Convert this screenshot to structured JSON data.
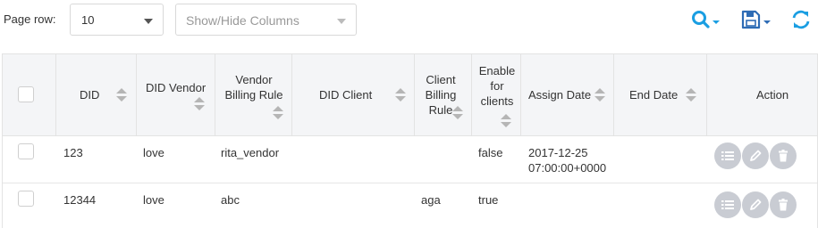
{
  "toolbar": {
    "page_row_label": "Page row:",
    "page_size_value": "10",
    "columns_placeholder": "Show/Hide Columns",
    "icons": {
      "search": "search-icon",
      "save": "save-icon",
      "refresh": "refresh-icon"
    },
    "accent_color": "#1a9ee2"
  },
  "table": {
    "columns": [
      {
        "key": "did",
        "label": "DID"
      },
      {
        "key": "did_vendor",
        "label": "DID Vendor"
      },
      {
        "key": "vendor_billing_rule",
        "label": "Vendor Billing Rule"
      },
      {
        "key": "did_client",
        "label": "DID Client"
      },
      {
        "key": "client_billing_rule",
        "label": "Client Billing Rule"
      },
      {
        "key": "enable_for_clients",
        "label": "Enable for clients"
      },
      {
        "key": "assign_date",
        "label": "Assign Date"
      },
      {
        "key": "end_date",
        "label": "End Date"
      },
      {
        "key": "action",
        "label": "Action"
      }
    ],
    "rows": [
      {
        "did": "123",
        "did_vendor": "love",
        "vendor_billing_rule": "rita_vendor",
        "did_client": "",
        "client_billing_rule": "",
        "enable_for_clients": "false",
        "assign_date_line1": "2017-12-25",
        "assign_date_line2": "07:00:00+0000",
        "end_date": ""
      },
      {
        "did": "12344",
        "did_vendor": "love",
        "vendor_billing_rule": "abc",
        "did_client": "",
        "client_billing_rule": "aga",
        "enable_for_clients": "true",
        "assign_date_line1": "",
        "assign_date_line2": "",
        "end_date": ""
      }
    ],
    "row_actions": [
      "list-icon",
      "edit-icon",
      "delete-icon"
    ]
  }
}
